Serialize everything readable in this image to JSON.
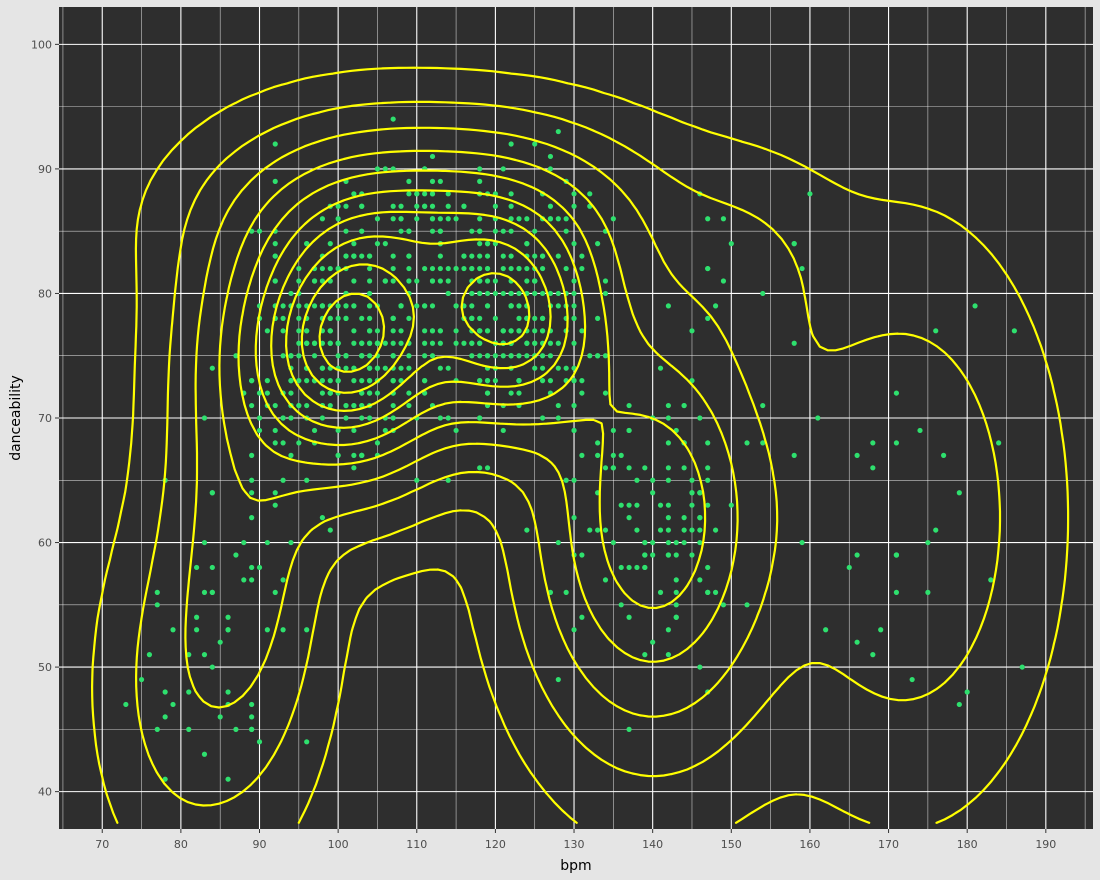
{
  "chart_data": {
    "type": "scatter",
    "title": "",
    "xlabel": "bpm",
    "ylabel": "danceability",
    "xlim": [
      64.5,
      196
    ],
    "ylim": [
      37,
      103
    ],
    "x_ticks": [
      70,
      80,
      90,
      100,
      110,
      120,
      130,
      140,
      150,
      160,
      170,
      180,
      190
    ],
    "y_ticks": [
      40,
      50,
      60,
      70,
      80,
      90,
      100
    ],
    "grid": true,
    "legend": "none",
    "colors": {
      "panel_background": "#2e2e2e",
      "page_background": "#e5e5e5",
      "grid": "#ffffff",
      "points": "#2ee06e",
      "density_contours": "#ffff00"
    },
    "point_count_approx": 900,
    "point_clusters": [
      {
        "x_range": [
          88,
          113
        ],
        "y_range": [
          62,
          86
        ]
      },
      {
        "x_range": [
          112,
          135
        ],
        "y_range": [
          65,
          85
        ]
      },
      {
        "x_range": [
          135,
          160
        ],
        "y_range": [
          45,
          75
        ]
      },
      {
        "x_range": [
          75,
          90
        ],
        "y_range": [
          40,
          80
        ]
      },
      {
        "x_range": [
          160,
          186
        ],
        "y_range": [
          40,
          80
        ]
      },
      {
        "x_range": [
          95,
          140
        ],
        "y_range": [
          86,
          96
        ]
      }
    ],
    "density_centers": [
      {
        "x": 101,
        "y": 75.5
      },
      {
        "x": 122,
        "y": 77.5
      }
    ]
  }
}
